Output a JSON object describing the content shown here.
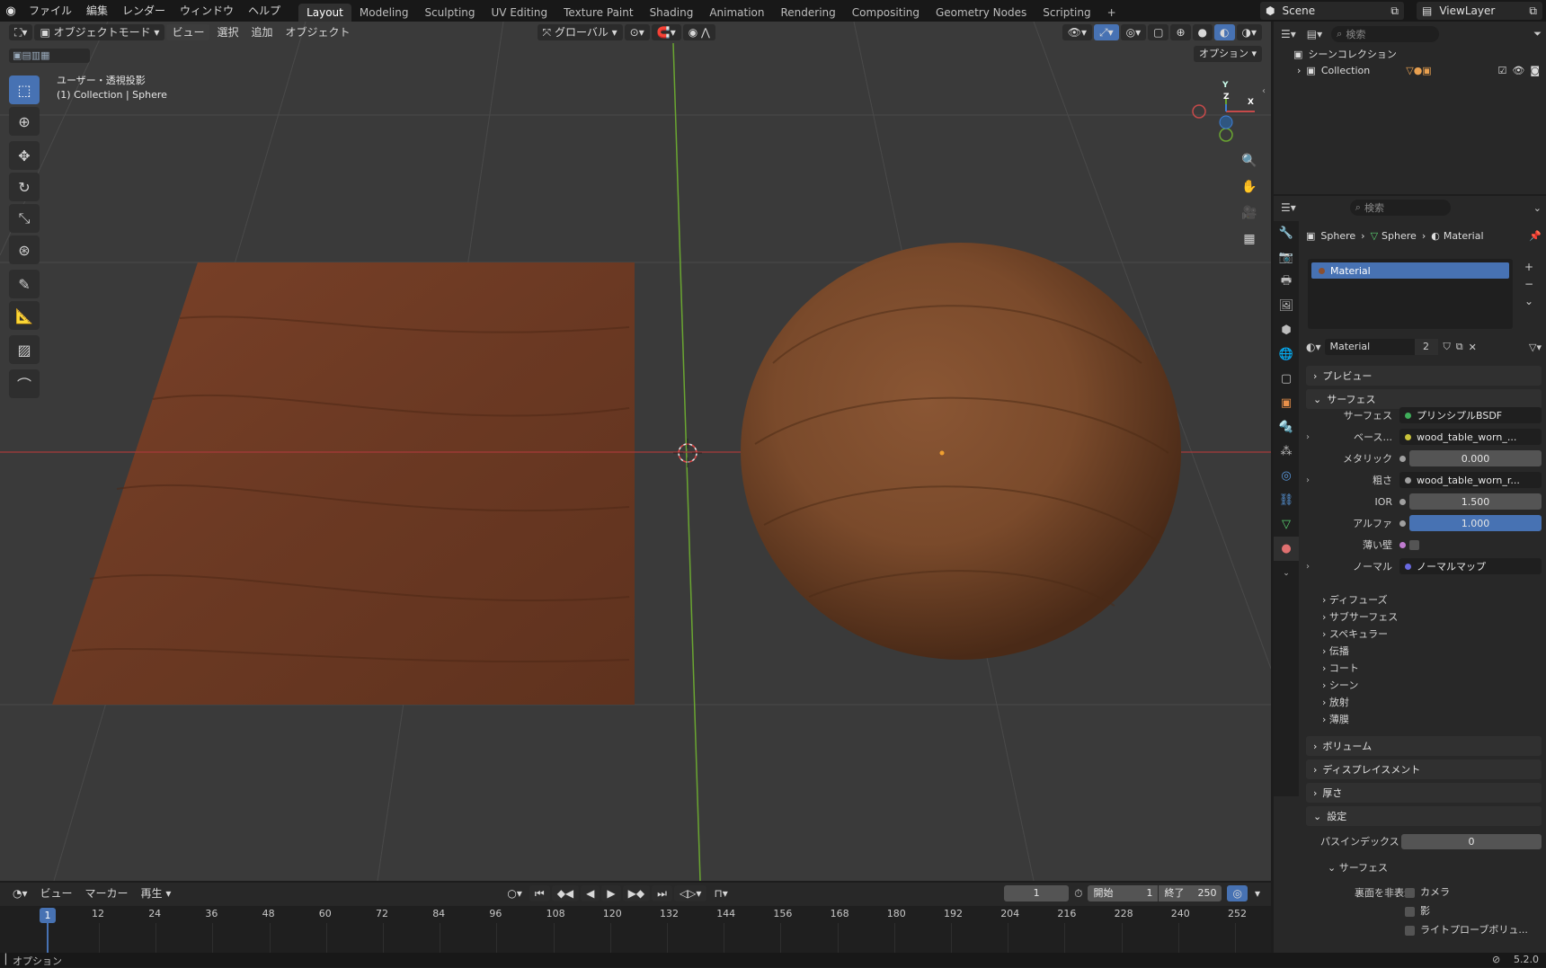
{
  "menus": [
    "ファイル",
    "編集",
    "レンダー",
    "ウィンドウ",
    "ヘルプ"
  ],
  "workspaces": [
    "Layout",
    "Modeling",
    "Sculpting",
    "UV Editing",
    "Texture Paint",
    "Shading",
    "Animation",
    "Rendering",
    "Compositing",
    "Geometry Nodes",
    "Scripting"
  ],
  "add_workspace": "+",
  "scene": "Scene",
  "view_layer": "ViewLayer",
  "viewport": {
    "mode": "オブジェクトモード",
    "menu": [
      "ビュー",
      "選択",
      "追加",
      "オブジェクト"
    ],
    "transform_orientation": "グローバル",
    "options_label": "オプション",
    "view_name": "ユーザー・透視投影",
    "collection_info": "(1) Collection | Sphere",
    "gizmo": {
      "x": "X",
      "y": "Y",
      "z": "Z"
    }
  },
  "outliner": {
    "search_placeholder": "検索",
    "scene_collection": "シーンコレクション",
    "collection": "Collection"
  },
  "properties": {
    "search_placeholder": "検索",
    "breadcrumb": [
      "Sphere",
      "Sphere",
      "Material"
    ],
    "material_slot": "Material",
    "material_name": "Material",
    "material_users": "2",
    "panels": {
      "preview": "プレビュー",
      "surface": "サーフェス",
      "volume": "ボリューム",
      "displacement": "ディスプレイスメント",
      "thickness": "厚さ",
      "settings": "設定"
    },
    "surface_rows": [
      {
        "label": "サーフェス",
        "value": "プリンシプルBSDF",
        "dot": "#3fae5a"
      },
      {
        "label": "ベース...",
        "value": "wood_table_worn_...",
        "dot": "#c8c23a"
      },
      {
        "label": "メタリック",
        "value": "0.000",
        "dot": "#a0a0a0"
      },
      {
        "label": "粗さ",
        "value": "wood_table_worn_r...",
        "dot": "#a0a0a0"
      },
      {
        "label": "IOR",
        "value": "1.500",
        "dot": "#a0a0a0"
      },
      {
        "label": "アルファ",
        "value": "1.000",
        "dot": "#a0a0a0"
      },
      {
        "label": "薄い壁",
        "value": "",
        "dot": "#c07bd0"
      },
      {
        "label": "ノーマル",
        "value": "ノーマルマップ",
        "dot": "#6a6ae0"
      }
    ],
    "subpanels": [
      "ディフューズ",
      "サブサーフェス",
      "スペキュラー",
      "伝播",
      "コート",
      "シーン",
      "放射",
      "薄膜"
    ],
    "pass_index_label": "パスインデックス",
    "pass_index": "0",
    "settings_surface": "サーフェス",
    "backface_label": "裏面を非表示",
    "backface_options": [
      "カメラ",
      "影",
      "ライトプローブボリュ..."
    ]
  },
  "timeline": {
    "menu": [
      "ビュー",
      "マーカー",
      "再生"
    ],
    "current_frame": "1",
    "start_label": "開始",
    "start": "1",
    "end_label": "終了",
    "end": "250",
    "ticks": [
      "12",
      "24",
      "36",
      "48",
      "60",
      "72",
      "84",
      "96",
      "108",
      "120",
      "132",
      "144",
      "156",
      "168",
      "180",
      "192",
      "204",
      "216",
      "228",
      "240",
      "252"
    ],
    "playhead": "1"
  },
  "status": {
    "left": "オプション",
    "version": "5.2.0"
  }
}
